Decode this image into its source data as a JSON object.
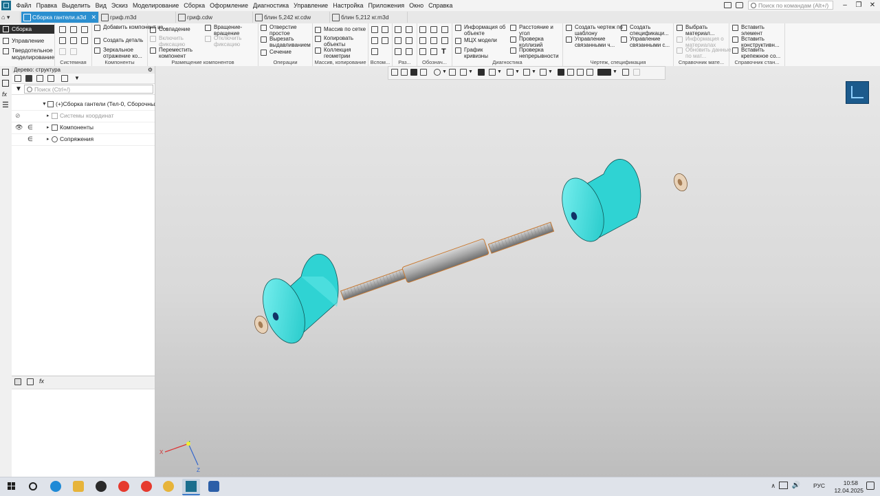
{
  "menu": {
    "items": [
      "Файл",
      "Правка",
      "Выделить",
      "Вид",
      "Эскиз",
      "Моделирование",
      "Сборка",
      "Оформление",
      "Диагностика",
      "Управление",
      "Настройка",
      "Приложения",
      "Окно",
      "Справка"
    ],
    "search_placeholder": "Поиск по командам (Alt+/)"
  },
  "tabs": [
    {
      "label": "Сборка гантели.a3d",
      "close": "✕"
    },
    {
      "label": "гриф.m3d"
    },
    {
      "label": "гриф.cdw"
    },
    {
      "label": "блин 5,242 кг.cdw"
    },
    {
      "label": "блин 5,212 кг.m3d"
    }
  ],
  "left_nav": [
    "Сборка",
    "Управление",
    "Твердотельное моделирование"
  ],
  "ribbon": {
    "groups": [
      "Системная",
      "Компоненты",
      "Размещение компонентов",
      "Операции",
      "Массив, копирование",
      "Вспом...",
      "Раз...",
      "Обознач...",
      "Диагностика",
      "Чертеж, спецификация",
      "Справочник мате...",
      "Справочник стан..."
    ],
    "components": {
      "add": "Добавить компонент из...",
      "create": "Создать деталь",
      "mirror": "Зеркальное отражение ко..."
    },
    "placement": {
      "coincide": "Совпадение",
      "rotate": "Вращение-вращение",
      "enable_fix": "Включить фиксацию",
      "disable_fix": "Отключить фиксацию",
      "move": "Переместить компонент"
    },
    "operations": {
      "hole": "Отверстие простое",
      "extrude_cut": "Вырезать выдавливанием",
      "section": "Сечение"
    },
    "array": {
      "grid": "Массив по сетке",
      "copy": "Копировать объекты",
      "collection": "Коллекция геометрии"
    },
    "diagnostics": {
      "info": "Информация об объекте",
      "mass": "МЦХ модели",
      "curvature": "График кривизны",
      "distance": "Расстояние и угол",
      "collisions": "Проверка коллизий",
      "continuity": "Проверка непрерывности"
    },
    "drawing": {
      "create_drawing": "Создать чертеж по шаблону",
      "create_spec": "Создать спецификаци...",
      "manage_linked": "Управление связанными ч...",
      "manage_linked_s": "Управление связанными с..."
    },
    "materials": {
      "choose": "Выбрать материал...",
      "info": "Информация о материалах",
      "update": "Обновить данные по мат..."
    },
    "standard": {
      "insert": "Вставить элемент",
      "insert_construct": "Вставить конструктивн...",
      "insert_fastener": "Вставить крепежное со..."
    }
  },
  "tree": {
    "title": "Дерево: структура",
    "search_placeholder": "Поиск (Ctrl+/)",
    "root": "(+)Сборка гантели (Тел-0, Сборочных",
    "rows": [
      "Системы координат",
      "Компоненты",
      "Сопряжения"
    ]
  },
  "taskbar": {
    "lang": "РУС",
    "time": "10:58",
    "date": "12.04.2025"
  },
  "axis": {
    "x": "X",
    "z": "Z"
  }
}
